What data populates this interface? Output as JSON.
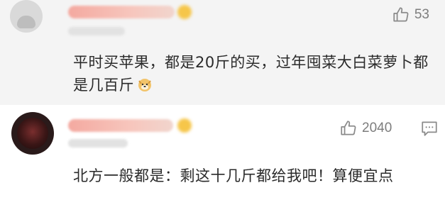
{
  "comments": [
    {
      "likes": "53",
      "text": "平时买苹果，都是20斤的买，过年囤菜大白菜萝卜都是几百斤",
      "emoji": "doge-icon"
    },
    {
      "likes": "2040",
      "text": "北方一般都是：剩这十几斤都给我吧！算便宜点"
    }
  ],
  "icons": {
    "like": "thumbs-up-icon",
    "reply": "comment-bubble-icon"
  },
  "colors": {
    "first_comment_bg": "#f4f4f4",
    "second_comment_bg": "#ffffff",
    "icon_gray": "#8a8a8a"
  }
}
